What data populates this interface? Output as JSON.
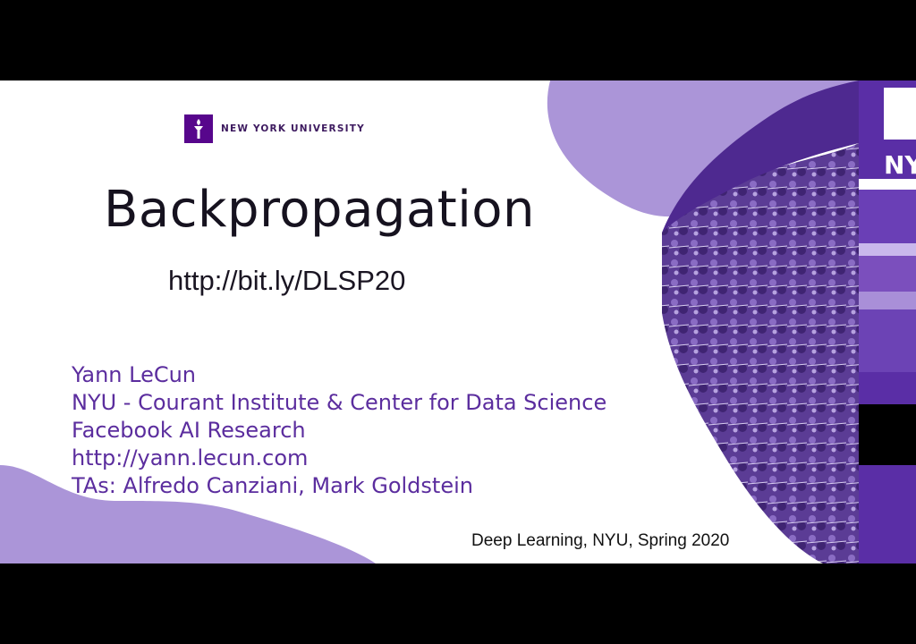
{
  "logo": {
    "text": "NEW YORK UNIVERSITY",
    "icon": "torch-icon"
  },
  "title": "Backpropagation",
  "url": "http://bit.ly/DLSP20",
  "author_lines": [
    "Yann LeCun",
    "NYU - Courant Institute & Center for Data Science",
    "Facebook AI Research",
    "http://yann.lecun.com",
    "TAs: Alfredo Canziani, Mark Goldstein"
  ],
  "course": "Deep Learning, NYU, Spring 2020",
  "side_logo": "NY",
  "colors": {
    "purple_dark": "#57068c",
    "purple_mid": "#7b4fbd",
    "purple_light": "#ab95d8"
  }
}
